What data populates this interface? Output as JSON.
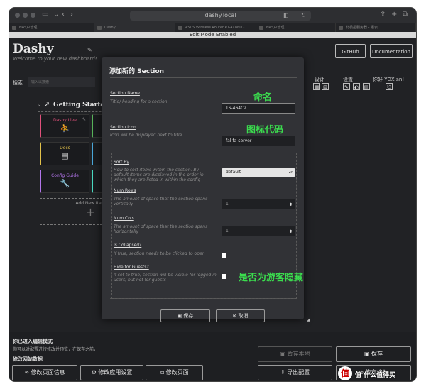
{
  "browser": {
    "url": "dashy.local",
    "tabs": [
      "NAS户管理",
      "Dashy",
      "ASUS Wireless Router RT-AX86U - ...",
      "NAS户管理",
      "北极星服务器 - 报表"
    ]
  },
  "edit_bar": "Edit Mode Enabled",
  "header": {
    "title": "Dashy",
    "subtitle": "Welcome to your new dashboard!",
    "github_label": "GitHub",
    "docs_label": "Documentation"
  },
  "search": {
    "label": "搜索",
    "placeholder": "输入以搜索"
  },
  "options": {
    "layout_label": "设计",
    "settings_label": "设置",
    "user_label": "你好 YDXian!"
  },
  "section": {
    "title": "Getting Started",
    "items": [
      {
        "label": "Dashy Live",
        "icon": "user-icon",
        "color": "#e0507a"
      },
      {
        "label": "Docs",
        "icon": "book-icon",
        "color": "#e2c14a"
      },
      {
        "label": "Config Guide",
        "icon": "wrench-icon",
        "color": "#b275ea"
      }
    ],
    "add_item_label": "Add New Item"
  },
  "bottom": {
    "notice_title": "你已进入编辑模式",
    "notice_text": "你可以对配置进行修改并预览，在保存之前，",
    "edit_data_label": "修改网站数据",
    "buttons": {
      "page_info": "修改页面信息",
      "app_settings": "修改应用设置",
      "edit_pages": "修改页面",
      "save_local": "暂存本地",
      "save": "保存",
      "export": "导出配置",
      "discard": "放弃修改"
    }
  },
  "modal": {
    "title": "添加新的 Section",
    "fields": {
      "section_name": {
        "label": "Section Name",
        "desc": "Title/ heading for a section",
        "value": "TS-464C2"
      },
      "section_icon": {
        "label": "Section Icon",
        "desc": "Icon will be displayed next to title",
        "value": "fal fa-server"
      },
      "sort_by": {
        "label": "Sort By",
        "desc": "How to sort items within the section. By default items are displayed in the order in which they are listed in within the config",
        "value": "default"
      },
      "num_rows": {
        "label": "Num Rows",
        "desc": "The amount of space that the section spans vertically",
        "value": "1"
      },
      "num_cols": {
        "label": "Num Cols",
        "desc": "The amount of space that the section spans horizontally",
        "value": "1"
      },
      "is_collapsed": {
        "label": "Is Collapsed?",
        "desc": "If true, section needs to be clicked to open"
      },
      "hide_guests": {
        "label": "Hide for Guests?",
        "desc": "If set to true, section will be visible for logged in users, but not for guests"
      }
    },
    "save_label": "保存",
    "cancel_label": "取消"
  },
  "annotations": {
    "name": "命名",
    "icon_code": "图标代码",
    "hide_guests": "是否为游客隐藏"
  },
  "watermark": "值 什么值得买",
  "colors": {
    "accent_green": "#3bdc4e",
    "background": "#212225",
    "modal": "#313236"
  }
}
